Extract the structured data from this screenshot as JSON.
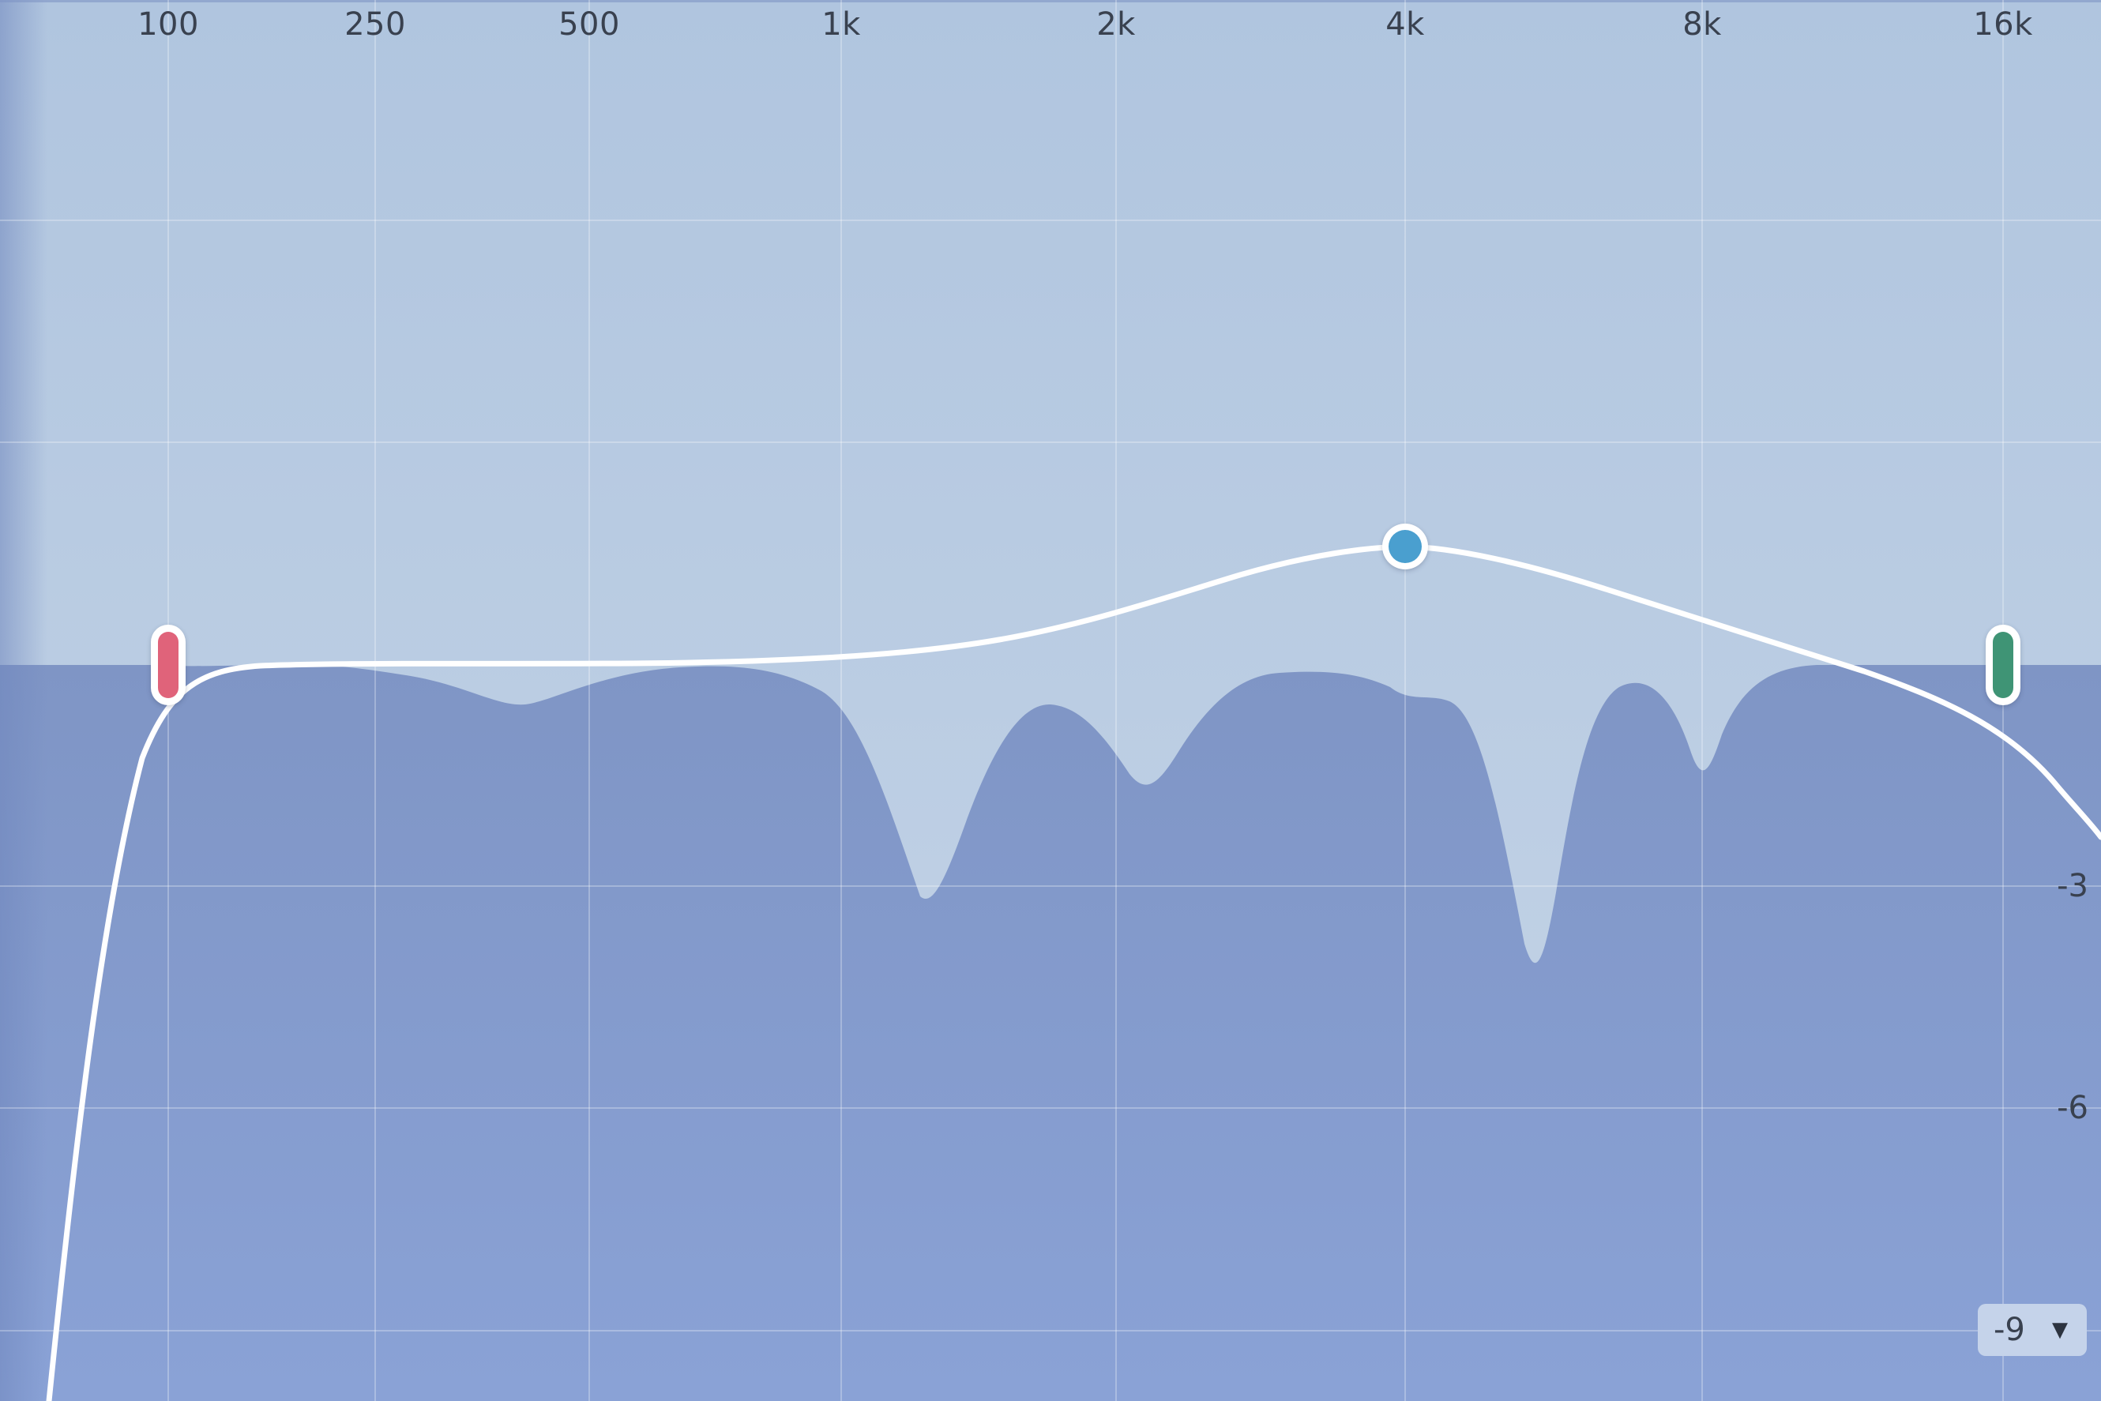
{
  "colors": {
    "top_bg": "#b1c6df",
    "spectrum_fill_top": "#7f95c5",
    "spectrum_fill_bottom": "#8aa2d6",
    "curve": "#ffffff",
    "grid": "#ffffff",
    "lowcut_handle": "#e0637a",
    "bell_handle": "#4a9fcf",
    "highcut_handle": "#3f9475",
    "text": "#39414f"
  },
  "frequency_axis": {
    "labels": [
      "100",
      "250",
      "500",
      "1k",
      "2k",
      "4k",
      "8k",
      "16k"
    ]
  },
  "db_axis": {
    "labels": [
      "-3",
      "-6"
    ]
  },
  "range_selector": {
    "value": "-9",
    "caret_icon": "triangle-down-icon"
  },
  "bands": [
    {
      "name": "low-cut",
      "icon": "pill-handle",
      "color": "#e0637a"
    },
    {
      "name": "bell",
      "icon": "circle-handle",
      "color": "#4a9fcf"
    },
    {
      "name": "high-cut",
      "icon": "pill-handle",
      "color": "#3f9475"
    }
  ]
}
